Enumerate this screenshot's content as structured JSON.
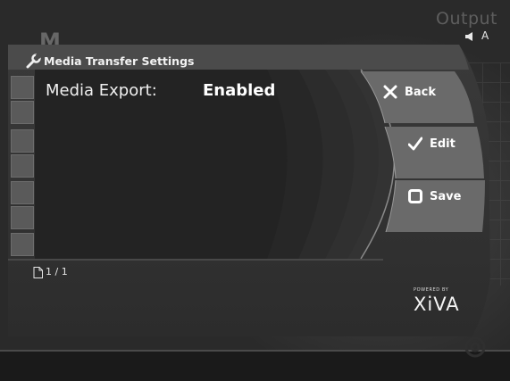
{
  "status": {
    "output_label": "Output",
    "audio_channel": "A"
  },
  "background": {
    "partial_title": "M"
  },
  "panel": {
    "title": "Media Transfer Settings",
    "setting": {
      "label": "Media Export:",
      "value": "Enabled"
    },
    "pager": "1 / 1"
  },
  "menu": {
    "back": "Back",
    "edit": "Edit",
    "save": "Save"
  },
  "branding": {
    "powered_by": "POWERED BY",
    "logo_text": "XiVA"
  }
}
